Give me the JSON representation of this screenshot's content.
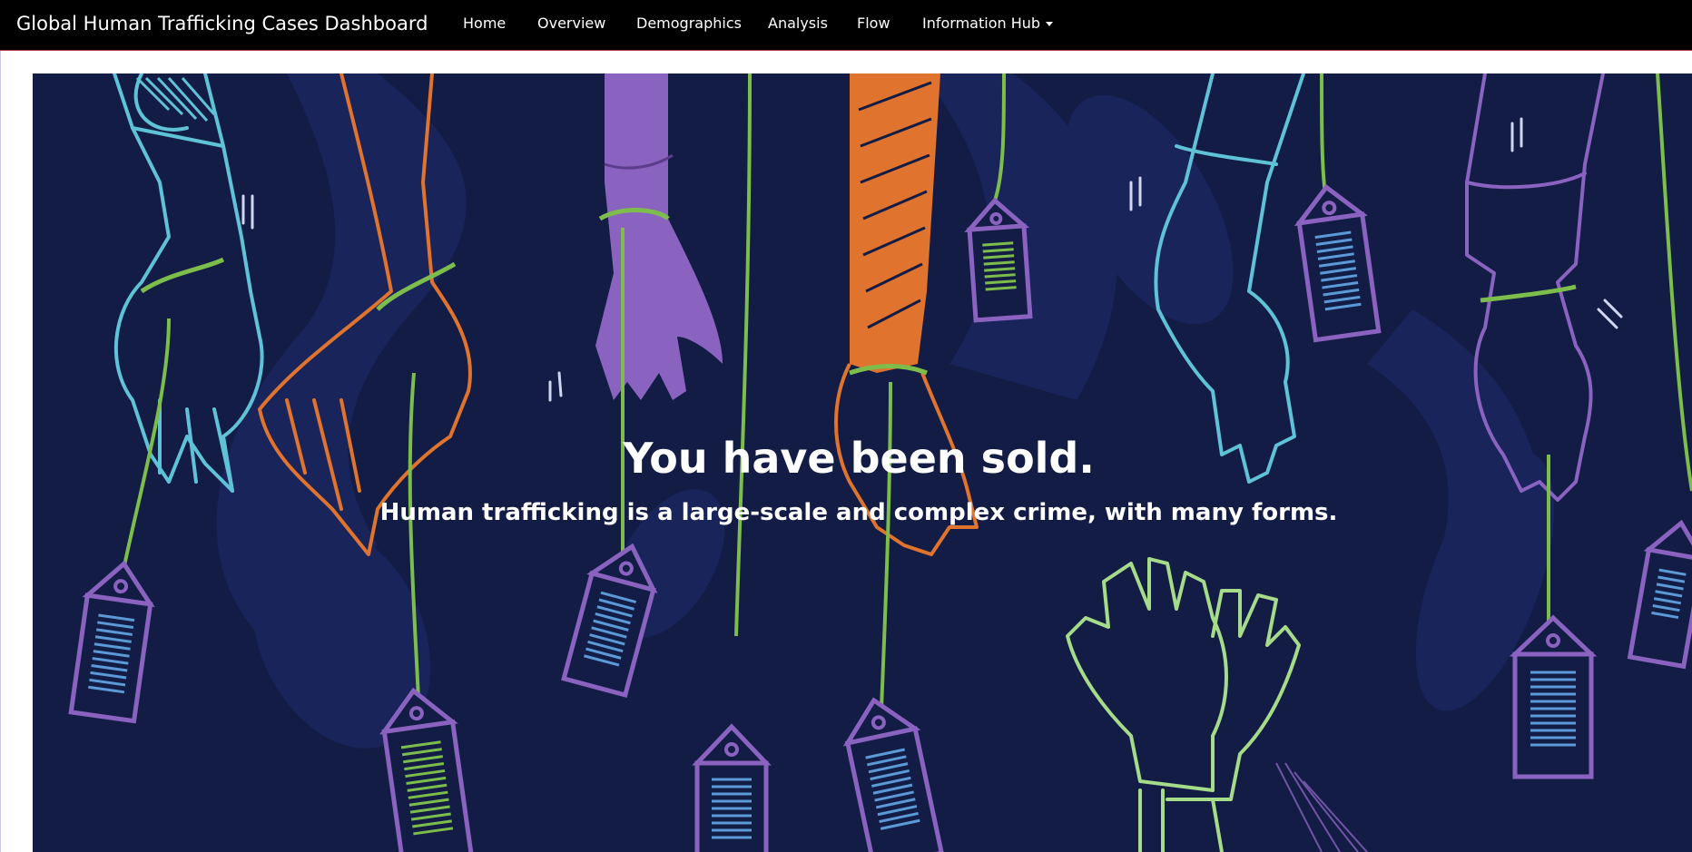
{
  "navbar": {
    "brand": "Global Human Trafficking Cases Dashboard",
    "items": [
      {
        "label": "Home"
      },
      {
        "label": "Overview"
      },
      {
        "label": "Demographics"
      },
      {
        "label": "Analysis"
      },
      {
        "label": "Flow"
      },
      {
        "label": "Information Hub",
        "has_dropdown": true
      }
    ],
    "dropdown_icon": "caret-down-icon"
  },
  "hero": {
    "title": "You have been sold.",
    "subtitle": "Human trafficking is a large-scale and complex crime, with many forms.",
    "illustration": "hands-with-barcode-price-tags",
    "colors": {
      "background": "#131c45",
      "teal": "#5fc2d6",
      "orange": "#e0742f",
      "purple": "#8a63c0",
      "green": "#7dbd4c",
      "light_green": "#a6db8a",
      "blue": "#5b9ad6"
    }
  }
}
